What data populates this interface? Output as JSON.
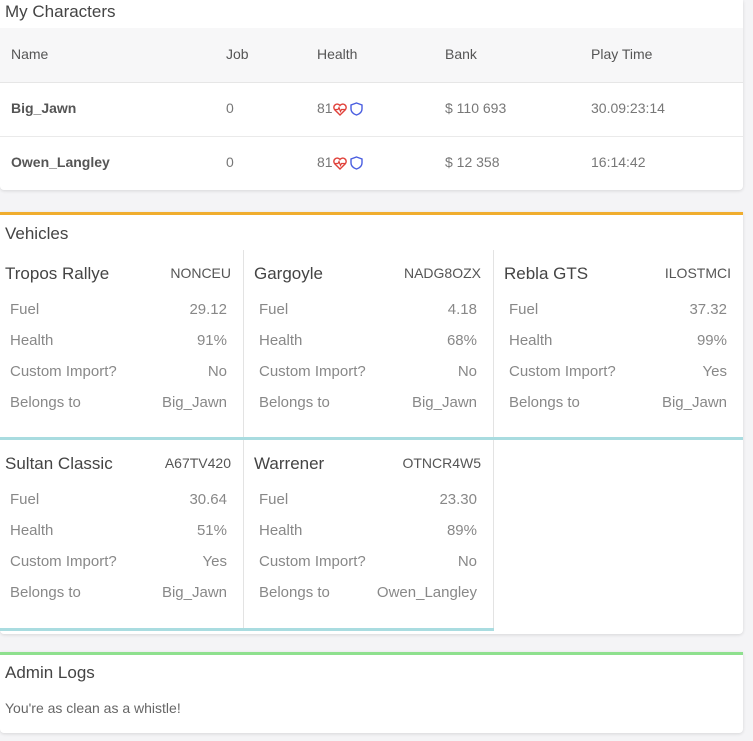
{
  "characters": {
    "title": "My Characters",
    "headers": {
      "name": "Name",
      "job": "Job",
      "health": "Health",
      "bank": "Bank",
      "play_time": "Play Time"
    },
    "rows": [
      {
        "name": "Big_Jawn",
        "job": "0",
        "health": "81",
        "bank": "$ 110 693",
        "play_time": "30.09:23:14"
      },
      {
        "name": "Owen_Langley",
        "job": "0",
        "health": "81",
        "bank": "$ 12 358",
        "play_time": "16:14:42"
      }
    ],
    "icons": {
      "heart": "heartbeat-icon",
      "armor": "shield-icon"
    },
    "colors": {
      "heart": "#e0413a",
      "armor": "#4a5ee0"
    }
  },
  "vehicles": {
    "title": "Vehicles",
    "labels": {
      "fuel": "Fuel",
      "health": "Health",
      "custom_import": "Custom Import?",
      "belongs_to": "Belongs to"
    },
    "items": [
      {
        "name": "Tropos Rallye",
        "plate": "NONCEU",
        "fuel": "29.12",
        "health": "91%",
        "custom_import": "No",
        "belongs_to": "Big_Jawn"
      },
      {
        "name": "Gargoyle",
        "plate": "NADG8OZX",
        "fuel": "4.18",
        "health": "68%",
        "custom_import": "No",
        "belongs_to": "Big_Jawn"
      },
      {
        "name": "Rebla GTS",
        "plate": "ILOSTMCI",
        "fuel": "37.32",
        "health": "99%",
        "custom_import": "Yes",
        "belongs_to": "Big_Jawn"
      },
      {
        "name": "Sultan Classic",
        "plate": "A67TV420",
        "fuel": "30.64",
        "health": "51%",
        "custom_import": "Yes",
        "belongs_to": "Big_Jawn"
      },
      {
        "name": "Warrener",
        "plate": "OTNCR4W5",
        "fuel": "23.30",
        "health": "89%",
        "custom_import": "No",
        "belongs_to": "Owen_Langley"
      }
    ],
    "accent": "#f0ad2e",
    "row_separator": "#a9dce0"
  },
  "admin_logs": {
    "title": "Admin Logs",
    "message": "You're as clean as a whistle!",
    "accent": "#8ee08e"
  }
}
